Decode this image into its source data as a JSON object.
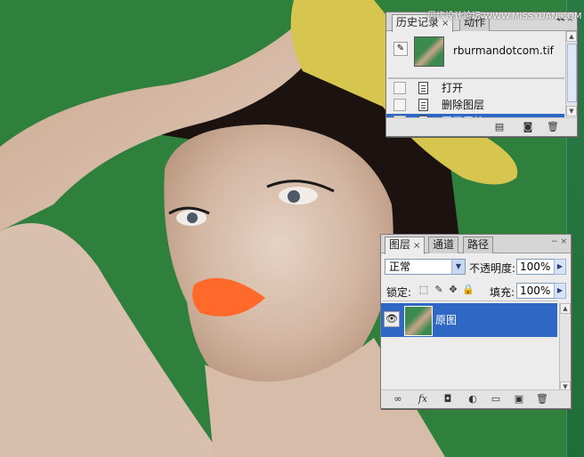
{
  "watermark": "思缘设计论坛 WWW.MISSYUAN.COM",
  "history_panel": {
    "tabs": [
      {
        "label": "历史记录",
        "close": "×",
        "active": true
      },
      {
        "label": "动作",
        "active": false
      }
    ],
    "window_controls": "◂◂ ×",
    "snapshot": {
      "icon": "snapshot-brush-icon",
      "name": "rburmandotcom.tif"
    },
    "items": [
      {
        "label": "打开",
        "selected": false
      },
      {
        "label": "删除图层",
        "selected": false
      },
      {
        "label": "图层属性",
        "selected": true
      }
    ],
    "footer_icons": [
      "new-document-from-state-icon",
      "create-snapshot-icon",
      "delete-state-icon"
    ]
  },
  "layers_panel": {
    "tabs": [
      {
        "label": "图层",
        "close": "×",
        "active": true
      },
      {
        "label": "通道",
        "active": false
      },
      {
        "label": "路径",
        "active": false
      }
    ],
    "window_controls": "− ×",
    "blend_mode": "正常",
    "opacity_label": "不透明度:",
    "opacity_value": "100%",
    "lock_label": "锁定:",
    "fill_label": "填充:",
    "fill_value": "100%",
    "layers": [
      {
        "name": "原图",
        "visible": true,
        "selected": true
      }
    ],
    "footer_icons": [
      "link-layers-icon",
      "layer-style-fx-icon",
      "add-mask-icon",
      "adjustment-layer-icon",
      "new-group-icon",
      "new-layer-icon",
      "delete-layer-icon"
    ]
  },
  "colors": {
    "selection": "#2f67c4",
    "background_green": "#2d7d3c",
    "panel_bg": "#ececec"
  }
}
